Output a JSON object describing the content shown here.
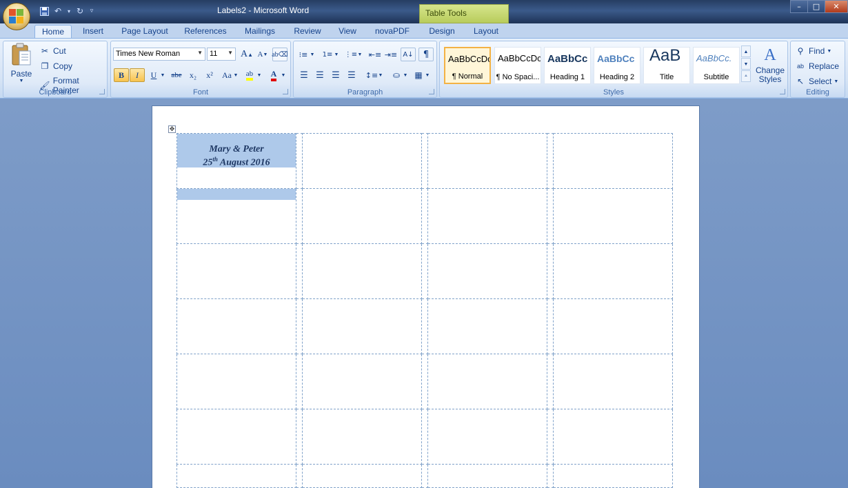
{
  "window": {
    "title": "Labels2 - Microsoft Word",
    "contextual_tab_group": "Table Tools"
  },
  "tabs": [
    {
      "label": "Home",
      "active": true
    },
    {
      "label": "Insert"
    },
    {
      "label": "Page Layout"
    },
    {
      "label": "References"
    },
    {
      "label": "Mailings"
    },
    {
      "label": "Review"
    },
    {
      "label": "View"
    },
    {
      "label": "novaPDF"
    },
    {
      "label": "Design"
    },
    {
      "label": "Layout"
    }
  ],
  "clipboard": {
    "paste": "Paste",
    "cut": "Cut",
    "copy": "Copy",
    "format_painter": "Format Painter",
    "label": "Clipboard"
  },
  "font": {
    "family": "Times New Roman",
    "size": "11",
    "label": "Font",
    "grow": "A",
    "shrink": "A",
    "bold": "B",
    "italic": "I",
    "underline": "U",
    "strikethrough": "abe",
    "subscript": "x₂",
    "superscript": "x²",
    "change_case": "Aa",
    "font_color": "A"
  },
  "paragraph": {
    "label": "Paragraph"
  },
  "styles": {
    "label": "Styles",
    "items": [
      {
        "preview": "AaBbCcDc",
        "name": "¶ Normal",
        "selected": true
      },
      {
        "preview": "AaBbCcDc",
        "name": "¶ No Spaci..."
      },
      {
        "preview": "AaBbCc",
        "name": "Heading 1"
      },
      {
        "preview": "AaBbCc",
        "name": "Heading 2"
      },
      {
        "preview": "AaB",
        "name": "Title"
      },
      {
        "preview": "AaBbCc.",
        "name": "Subtitle"
      }
    ],
    "change_styles": "Change Styles"
  },
  "editing": {
    "label": "Editing",
    "find": "Find",
    "replace": "Replace",
    "select": "Select"
  },
  "document": {
    "label_line1": "Mary & Peter",
    "label_day": "25",
    "label_sup": "th",
    "label_rest": " August 2016"
  },
  "colors": {
    "selection": "#aec9ea",
    "label_text": "#1f3864",
    "ribbon_text": "#15428b"
  }
}
